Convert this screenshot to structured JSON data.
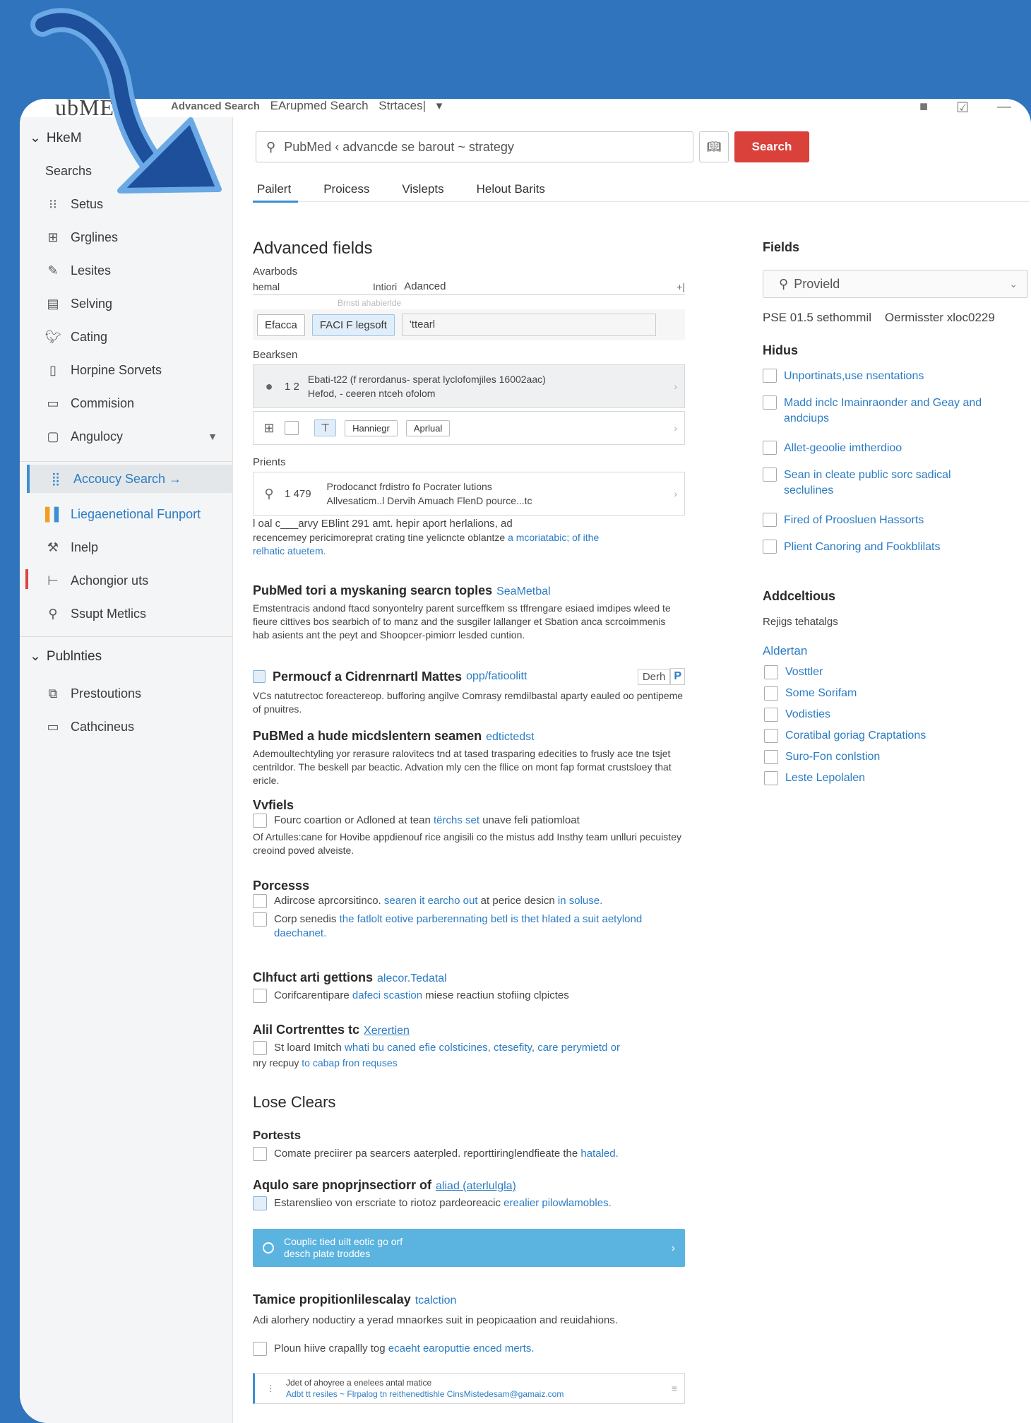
{
  "topbar": {
    "logo": "ubMED",
    "crumbs": [
      "Advanced Search",
      "EArupmed Search",
      "Strtaces|"
    ],
    "crumb_dropdown": "▾"
  },
  "sidebar": {
    "group1": "HkeM",
    "items": [
      {
        "label": "Searchs",
        "icon": ""
      },
      {
        "label": "Setus",
        "icon": "grid-list-icon"
      },
      {
        "label": "Grglines",
        "icon": "layout-icon"
      },
      {
        "label": "Lesites",
        "icon": "pen-icon"
      },
      {
        "label": "Selving",
        "icon": "document-icon"
      },
      {
        "label": "Cating",
        "icon": "bird-icon"
      },
      {
        "label": "Horpine Sorvets",
        "icon": "file-icon"
      },
      {
        "label": "Commision",
        "icon": "stack-icon"
      },
      {
        "label": "Angulocy",
        "icon": "folder-icon"
      },
      {
        "label": "Accoucy Search →",
        "icon": "dots-icon"
      },
      {
        "label": "Liegaenetional Funport",
        "icon": "color-bars-icon"
      },
      {
        "label": "Inelp",
        "icon": "wrench-icon"
      },
      {
        "label": "Achongior uts",
        "icon": "bracket-icon"
      },
      {
        "label": "Ssupt Metlics",
        "icon": "search-person-icon"
      }
    ],
    "group2": "Publnties",
    "items2": [
      {
        "label": "Prestoutions",
        "icon": "window-icon"
      },
      {
        "label": "Cathcineus",
        "icon": "chat-icon"
      }
    ]
  },
  "search": {
    "value": "PubMed ‹ advancde se barout ~ strategy",
    "button": "Search"
  },
  "tabs": [
    "Pailert",
    "Proicess",
    "Vislepts",
    "Helout Barits"
  ],
  "main": {
    "advanced_title": "Advanced fields",
    "avarbods_label": "Avarbods",
    "field1_value": "hemal",
    "field2_label": "Intiori",
    "field2_value": "Adanced",
    "plus": "+|",
    "faded": "Brnsti ahabierlde",
    "chip1": "Efacca",
    "chip2": "FACI F legsoft",
    "chip3_value": "'ttearl",
    "bearksen": "Bearksen",
    "card1_num": "1 2",
    "card1_line1": "Ebati-t22 (f rerordanus- sperat lyclofomjiles 16002aac)",
    "card1_line2": "Hefod, - ceeren ntceh ofolom",
    "card2_chip1": "Hanniegr",
    "card2_chip2": "Aprlual",
    "prients": "Prients",
    "card3_num": "1 479",
    "card3_line1": "Prodocanct frdistro fo Pocrater lutions",
    "card3_line2": "Allvesaticm..l Dervih Amuach FlenD pource...tc",
    "card3_line3": "l oal c___arvy EBlint 291 amt. hepir aport herlalions, ad",
    "para1a": "recencemey pericimoreprat crating tine yelicncte oblantze",
    "para1b": "a mcoriatabic; of ithe",
    "para1c": "relhatic atuetem.",
    "s1_title": "PubMed tori a myskaning searcn toples",
    "s1_link": "SeaMetbal",
    "s1_para": "Emstentracis andond ftacd sonyontelry parent surceffkem ss tffrengare esiaed imdipes wleed te fieure cittives bos searbich of to manz and the susgiler lallanger et Sbation anca scrcoimmenis hab asients ant the peyt and Shoopcer-pimiorr lesded cuntion.",
    "s2_title": "Permoucf a Cidrenrnartl Mattes",
    "s2_link": "opp/fatioolitt",
    "s2_side": "Derh",
    "s2_p": "P",
    "s2_para": "VCs natutrectoc foreactereop. bufforing angilve Comrasy remdilbastal aparty eauled oo pentipeme of pnuitres.",
    "s3_title": "PuBMed a hude micdslentern seamen",
    "s3_link": "edtictedst",
    "s3_para": "Ademoultechtyling yor rerasure ralovitecs tnd at tased trasparing edecities to frusly ace tne tsjet centrildor. The beskell par beactic. Advation mly cen the fllice on mont fap format crustsloey that ericle.",
    "s4_title": "Vvfiels",
    "s4_line1a": "Fourc coartion or Adloned at tean",
    "s4_line1b": "tërchs set",
    "s4_line1c": "unave feli patiomloat",
    "s4_para": "Of Artulles:cane for Hovibe appdienouf rice angisili co the mistus add Insthy team unlluri pecuistey creoind poved alveiste.",
    "s5_title": "Porcesss",
    "s5_c1a": "Adircose aprcorsitinco.",
    "s5_c1b": "searen it earcho out",
    "s5_c1c": "at perice desicn",
    "s5_c1d": "in soluse.",
    "s5_c2a": "Corp senedis",
    "s5_c2b": "the fatlolt eotive parberennating betl is thet hlated a suit aetylond daechanet.",
    "s6_title": "Clhfuct arti gettions",
    "s6_link": "alecor.Tedatal",
    "s6_c1a": "Corifcarentipare",
    "s6_c1b": "dafeci scastion",
    "s6_c1c": "miese reactiun stofiing clpictes",
    "s7_title": "Alil Cortrenttes tc",
    "s7_link": "Xerertien",
    "s7_c1a": "St loard Imitch",
    "s7_c1b": "whati bu caned efie colsticines, ctesefity, care perymietd or",
    "s7_c1c": "nry recpuy",
    "s7_c1d": "to cabap fron requses",
    "lose_title": "Lose Clears",
    "portests": "Portests",
    "p_c1a": "Comate preciirer pa searcers aaterpled. reporttiringlendfieate the",
    "p_c1b": "hataled.",
    "aqulo_title": "Aqulo sare pnoprjnsectiorr of",
    "aqulo_link": "aliad (aterlulgla)",
    "aqulo_c1a": "Estarenslieo von erscriate to riotoz pardeoreacic",
    "aqulo_c1b": "erealier pilowlamobles.",
    "banner_line1": "Couplic tied uilt eotic go orf",
    "banner_line2": "desch plate troddes",
    "tamice_title": "Tamice propitionlilescalay",
    "tamice_link": "tcalction",
    "tamice_para": "Adi alorhery noductiry a yerad mnaorkes suit in peopicaation and reuidahions.",
    "tamice_c1a": "Ploun hiive crapallly tog",
    "tamice_c1b": "ecaeht earoputtie enced merts.",
    "foot_line1": "Jdet of ahoyree a enelees antal matice",
    "foot_line2": "Adbt tt resiles ~ Flrpalog tn reithenedtishle CinsMistedesam@gamaiz.com"
  },
  "right": {
    "fields_title": "Fields",
    "select_value": "Provield",
    "sub_a": "PSE 01.5 sethommil",
    "sub_b": "Oermisster xloc0229",
    "hidus_title": "Hidus",
    "hidus_items": [
      "Unportinats,use nsentations",
      "Madd inclc Imainraonder and Geay and andciups",
      "Allet-geoolie imtherdioo",
      "Sean in cleate public sorc sadical seclulines",
      "Fired of Proosluen Hassorts",
      "Plient Canoring and Fookblilats"
    ],
    "add_title": "Addceltious",
    "rejigs": "Rejigs tehatalgs",
    "aldertan": "Aldertan",
    "add_items": [
      "Vosttler",
      "Some Sorifam",
      "Vodisties",
      "Coratibal goriag Craptations",
      "Suro-Fon conlstion",
      "Leste Lepolalen"
    ]
  }
}
